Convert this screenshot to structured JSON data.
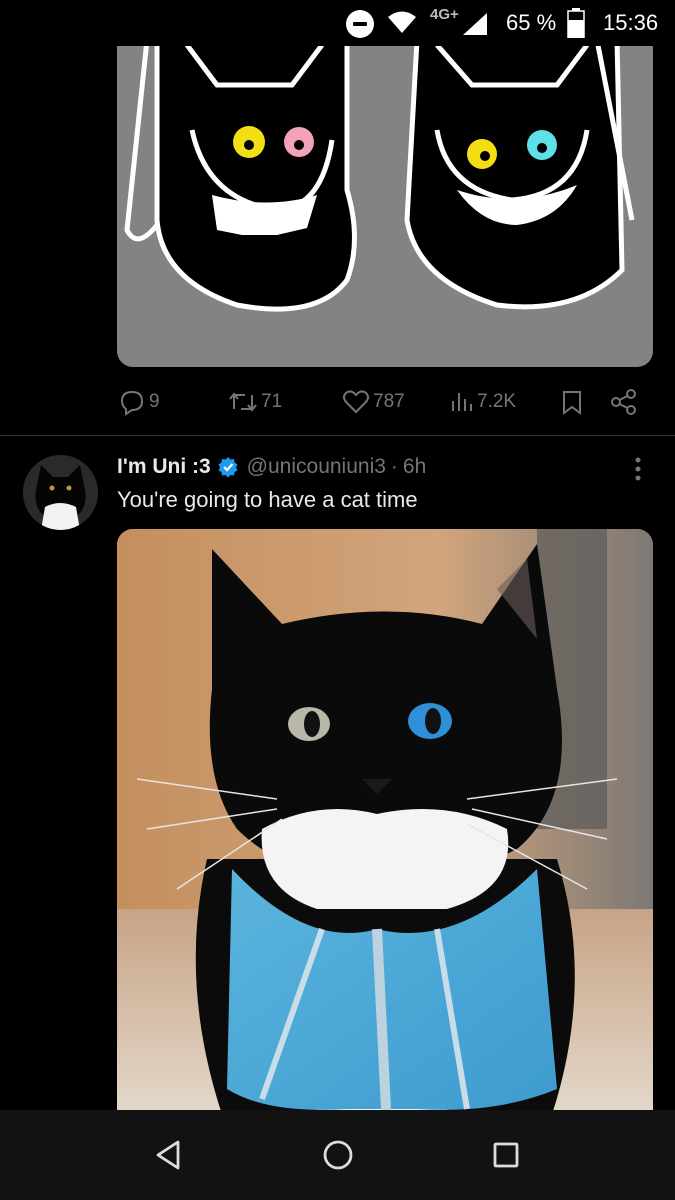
{
  "status_bar": {
    "network_type": "4G+",
    "battery_percent": "65 %",
    "time": "15:36",
    "icons": [
      "do-not-disturb-icon",
      "wifi-icon",
      "cell-signal-icon",
      "battery-icon"
    ]
  },
  "previous_tweet": {
    "media_description": "two black cat faces with grins",
    "actions": {
      "replies": "9",
      "reposts": "71",
      "likes": "787",
      "views": "7.2K"
    }
  },
  "tweet": {
    "display_name": "I'm Uni :3",
    "handle": "@unicouniuni3",
    "separator": "·",
    "timestamp": "6h",
    "text": "You're going to have a cat time"
  },
  "colors": {
    "background": "#000000",
    "text_primary": "#e7e9ea",
    "text_secondary": "#71767b",
    "verified_blue": "#1d9bf0",
    "divider": "#2f3336",
    "nav_bar": "#121212"
  },
  "nav_bar": {
    "buttons": [
      "back-icon",
      "home-icon",
      "recents-icon"
    ]
  }
}
